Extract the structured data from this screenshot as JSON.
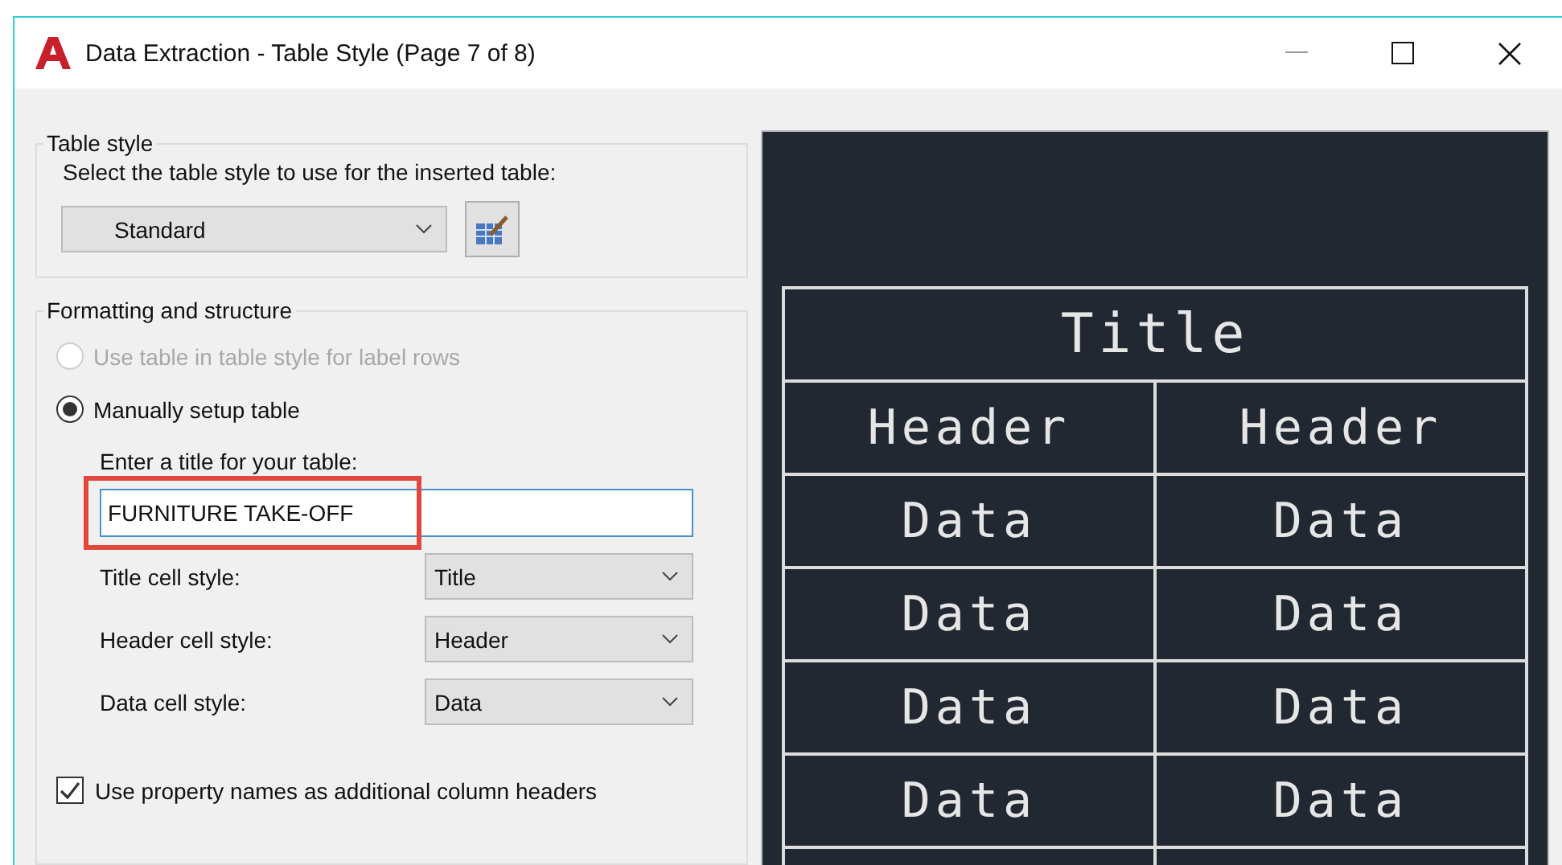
{
  "window": {
    "title": "Data Extraction - Table Style (Page 7 of 8)"
  },
  "table_style_group": {
    "title": "Table style",
    "prompt": "Select the table style to use for the inserted table:",
    "style_select": {
      "value": "Standard"
    }
  },
  "formatting_group": {
    "title": "Formatting and structure",
    "options": [
      {
        "label": "Use table in table style for label rows",
        "selected": false,
        "disabled": true
      },
      {
        "label": "Manually setup table",
        "selected": true,
        "disabled": false
      }
    ],
    "title_prompt": "Enter a title for your table:",
    "title_field": {
      "value": "FURNITURE TAKE-OFF",
      "highlighted": true
    },
    "cell_styles": [
      {
        "label": "Title cell style:",
        "value": "Title"
      },
      {
        "label": "Header cell style:",
        "value": "Header"
      },
      {
        "label": "Data cell style:",
        "value": "Data"
      }
    ],
    "property_names_checkbox": {
      "label": "Use property names as additional column headers",
      "checked": true
    }
  },
  "preview": {
    "title": "Title",
    "headers": [
      "Header",
      "Header"
    ],
    "rows": [
      [
        "Data",
        "Data"
      ],
      [
        "Data",
        "Data"
      ],
      [
        "Data",
        "Data"
      ],
      [
        "Data",
        "Data"
      ]
    ]
  }
}
